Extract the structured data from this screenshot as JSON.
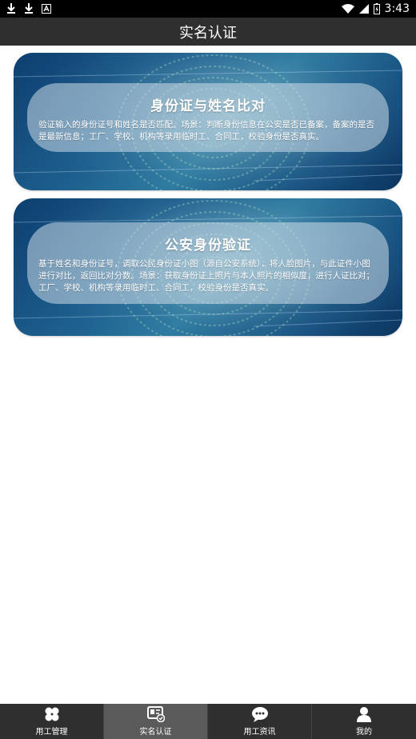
{
  "status_bar": {
    "time": "3:43",
    "left_icons": [
      "download-icon",
      "download-icon",
      "text-a-icon"
    ],
    "right_icons": [
      "wifi-icon",
      "signal-icon",
      "battery-icon"
    ]
  },
  "header": {
    "title": "实名认证"
  },
  "cards": [
    {
      "title": "身份证与姓名比对",
      "description": "验证输入的身份证号和姓名是否匹配。场景：判断身份信息在公安是否已备案，备案的是否是最新信息；工厂、学校、机构等录用临时工、合同工，校验身份是否真实。"
    },
    {
      "title": "公安身份验证",
      "description": "基于姓名和身份证号，调取公民身份证小图（源自公安系统），将人脸图片，与此证件小图进行对比，返回比对分数。场景：获取身份证上照片与本人照片的相似度，进行人证比对；工厂、学校、机构等录用临时工、合同工，校验身份是否真实。"
    }
  ],
  "bottom_nav": {
    "items": [
      {
        "label": "用工管理",
        "icon": "grid-icon",
        "active": false
      },
      {
        "label": "实名认证",
        "icon": "id-card-icon",
        "active": true
      },
      {
        "label": "用工资讯",
        "icon": "chat-icon",
        "active": false
      },
      {
        "label": "我的",
        "icon": "user-icon",
        "active": false
      }
    ]
  },
  "colors": {
    "status_bar_bg": "#000000",
    "title_bar_bg": "#2f2f2f",
    "nav_bg": "#2f2f2f",
    "nav_active_bg": "#5a5a5a",
    "card_blue": "#1d5f8e"
  }
}
